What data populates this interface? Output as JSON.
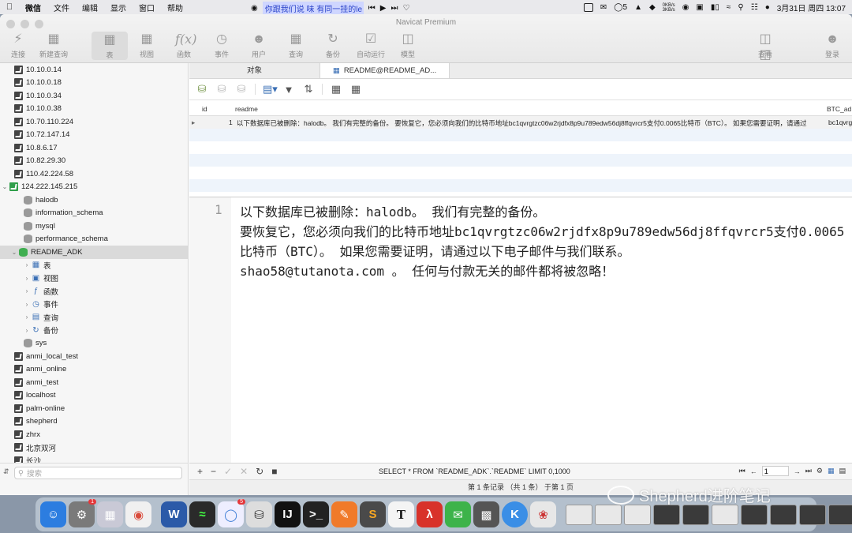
{
  "menubar": {
    "app": "微信",
    "items": [
      "文件",
      "编辑",
      "显示",
      "窗口",
      "帮助"
    ],
    "song": "你跟我们说 味 有同一挂的le",
    "notif_count": "5",
    "net_up": "0KB/s",
    "net_down": "3KB/s",
    "clock": "3月31日 周四  13:07"
  },
  "window": {
    "title": "Navicat Premium"
  },
  "toolbar": {
    "items": [
      {
        "label": "连接",
        "icon": "plug-icon"
      },
      {
        "label": "新建查询",
        "icon": "new-query-icon"
      },
      {
        "label": "表",
        "icon": "table-icon"
      },
      {
        "label": "视图",
        "icon": "view-icon"
      },
      {
        "label": "函数",
        "icon": "function-icon",
        "glyph": "f(x)"
      },
      {
        "label": "事件",
        "icon": "clock-icon"
      },
      {
        "label": "用户",
        "icon": "user-icon"
      },
      {
        "label": "查询",
        "icon": "query-icon"
      },
      {
        "label": "备份",
        "icon": "backup-icon"
      },
      {
        "label": "自动运行",
        "icon": "automation-icon"
      },
      {
        "label": "模型",
        "icon": "model-icon"
      }
    ],
    "view_label": "查看",
    "login_label": "登录"
  },
  "sidebar": {
    "connections_top": [
      "10.10.0.14",
      "10.10.0.18",
      "10.10.0.34",
      "10.10.0.38",
      "10.70.110.224",
      "10.72.147.14",
      "10.8.6.17",
      "10.82.29.30",
      "110.42.224.58"
    ],
    "open_connection": "124.222.145.215",
    "databases_before": [
      "halodb",
      "information_schema",
      "mysql",
      "performance_schema"
    ],
    "selected_db": "README_ADK",
    "objects": [
      "表",
      "视图",
      "函数",
      "事件",
      "查询",
      "备份"
    ],
    "db_after": "sys",
    "connections_bottom": [
      "anmi_local_test",
      "anmi_online",
      "anmi_test",
      "localhost",
      "palm-online",
      "shepherd",
      "zhrx",
      "北京双河",
      "长沙"
    ],
    "search_placeholder": "搜索"
  },
  "tabs": {
    "objects": "对象",
    "table_tab": "README@README_AD..."
  },
  "grid": {
    "columns": [
      "id",
      "readme",
      "BTC_ad"
    ],
    "row": {
      "id": "1",
      "readme": "以下数据库已被删除：halodb。 我们有完整的备份。 要恢复它，您必须向我们的比特币地址bc1qvrgtzc06w2rjdfx8p9u789edw56dj8ffqvrcr5支付0.0065比特币（BTC）。 如果您需要证明，请通过",
      "btc": "bc1qvrg"
    }
  },
  "viewer": {
    "line_number": "1",
    "text": "以下数据库已被删除：halodb。 我们有完整的备份。\n要恢复它，您必须向我们的比特币地址bc1qvrgtzc06w2rjdfx8p9u789edw56dj8ffqvrcr5支付0.0065比特币（BTC）。 如果您需要证明，请通过以下电子邮件与我们联系。\nshao58@tutanota.com 。 任何与付款无关的邮件都将被忽略！"
  },
  "bottombar": {
    "sql": "SELECT * FROM `README_ADK`.`README` LIMIT 0,1000",
    "page": "1"
  },
  "status": {
    "text": "第 1 条记录 （共 1 条） 于第 1 页"
  },
  "dock": {
    "sysprefs_badge": "1",
    "qq_badge": "5"
  },
  "watermark": {
    "text": "Shepherd进阶笔记"
  }
}
